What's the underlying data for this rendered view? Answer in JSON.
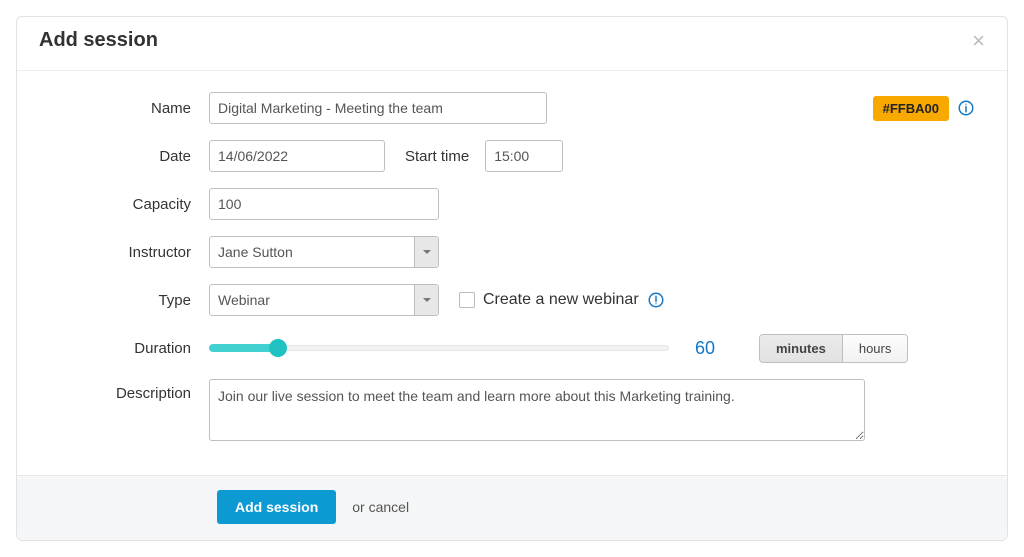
{
  "header": {
    "title": "Add session"
  },
  "labels": {
    "name": "Name",
    "date": "Date",
    "start_time": "Start time",
    "capacity": "Capacity",
    "instructor": "Instructor",
    "type": "Type",
    "duration": "Duration",
    "description": "Description",
    "create_webinar": "Create a new webinar"
  },
  "fields": {
    "name": "Digital Marketing - Meeting the team",
    "date": "14/06/2022",
    "start_time": "15:00",
    "capacity": "100",
    "instructor": "Jane Sutton",
    "type": "Webinar",
    "duration_value": "60",
    "description": "Join our live session to meet the team and learn more about this Marketing training."
  },
  "color": {
    "badge": "#FFBA00"
  },
  "units": {
    "minutes": "minutes",
    "hours": "hours"
  },
  "actions": {
    "submit": "Add session",
    "or_cancel": "or cancel"
  }
}
